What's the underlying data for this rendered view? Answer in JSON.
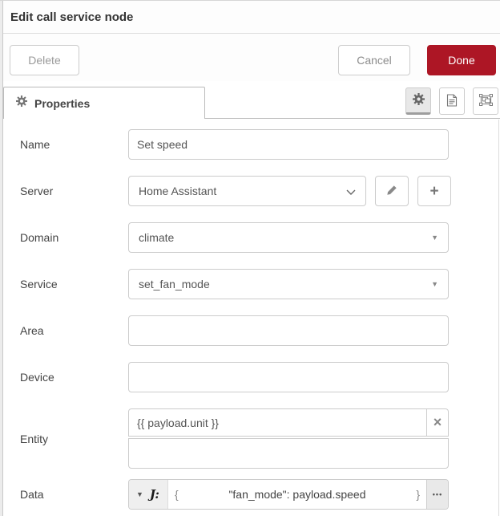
{
  "dialog": {
    "title": "Edit call service node",
    "toolbar": {
      "delete_label": "Delete",
      "cancel_label": "Cancel",
      "done_label": "Done"
    },
    "tabs": {
      "properties_label": "Properties"
    },
    "tab_icons": [
      "gear-icon",
      "document-icon",
      "object-group-icon"
    ]
  },
  "form": {
    "name": {
      "label": "Name",
      "value": "Set speed"
    },
    "server": {
      "label": "Server",
      "value": "Home Assistant"
    },
    "domain": {
      "label": "Domain",
      "value": "climate"
    },
    "service": {
      "label": "Service",
      "value": "set_fan_mode"
    },
    "area": {
      "label": "Area",
      "value": ""
    },
    "device": {
      "label": "Device",
      "value": ""
    },
    "entity": {
      "label": "Entity",
      "value": "{{ payload.unit }}",
      "second_value": ""
    },
    "data": {
      "label": "Data",
      "type_glyph": "J:",
      "open_brace": "{",
      "expression": "\"fan_mode\": payload.speed",
      "close_brace": "}"
    }
  },
  "glyphs": {
    "caret_down": "▼",
    "remove_x": "×",
    "plus": "+",
    "dots": "•••"
  },
  "colors": {
    "accent_red": "#ad1625",
    "input_border": "#cccccc",
    "tab_border": "#bbbbbb",
    "label_text": "#444444"
  }
}
